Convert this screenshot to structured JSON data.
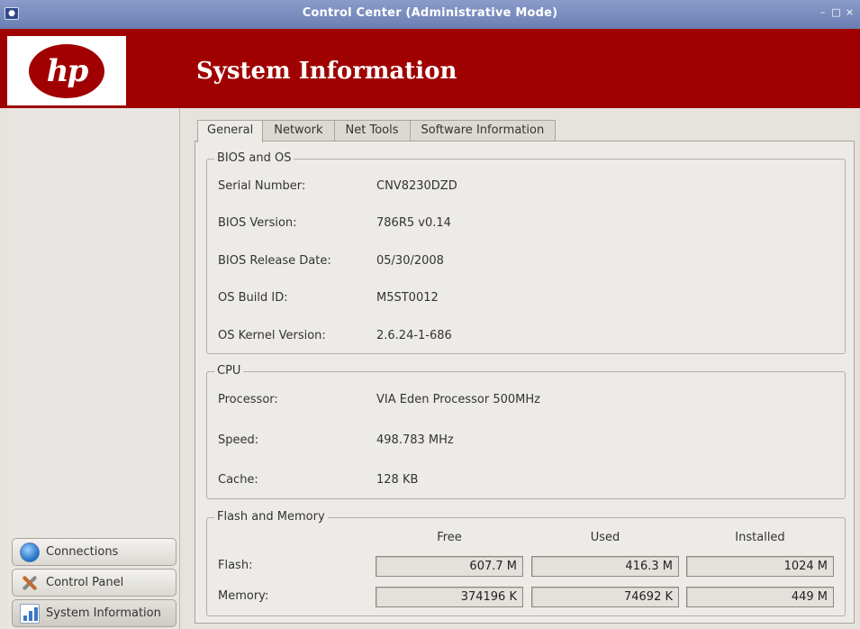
{
  "window": {
    "title": "Control Center (Administrative Mode)",
    "controls": [
      "–",
      "□",
      "×"
    ]
  },
  "header": {
    "logo_text": "hp",
    "page_title": "System Information",
    "brand_color": "#9f0000"
  },
  "sidebar": {
    "items": [
      {
        "label": "Connections",
        "icon": "globe-icon"
      },
      {
        "label": "Control Panel",
        "icon": "tools-icon"
      },
      {
        "label": "System Information",
        "icon": "chart-icon",
        "active": true
      }
    ]
  },
  "tabs": [
    {
      "label": "General",
      "active": true
    },
    {
      "label": "Network"
    },
    {
      "label": "Net Tools"
    },
    {
      "label": "Software Information"
    }
  ],
  "bios_os": {
    "title": "BIOS and OS",
    "rows": [
      {
        "label": "Serial Number:",
        "value": "CNV8230DZD"
      },
      {
        "label": "BIOS Version:",
        "value": "786R5 v0.14"
      },
      {
        "label": "BIOS Release Date:",
        "value": "05/30/2008"
      },
      {
        "label": "OS Build ID:",
        "value": "M5ST0012"
      },
      {
        "label": "OS Kernel Version:",
        "value": "2.6.24-1-686"
      }
    ]
  },
  "cpu": {
    "title": "CPU",
    "rows": [
      {
        "label": "Processor:",
        "value": "VIA Eden Processor  500MHz"
      },
      {
        "label": "Speed:",
        "value": "498.783 MHz"
      },
      {
        "label": "Cache:",
        "value": "128 KB"
      }
    ]
  },
  "flash_memory": {
    "title": "Flash and Memory",
    "columns": [
      "Free",
      "Used",
      "Installed"
    ],
    "rows": [
      {
        "label": "Flash:",
        "values": [
          "607.7 M",
          "416.3 M",
          "1024 M"
        ]
      },
      {
        "label": "Memory:",
        "values": [
          "374196 K",
          "74692 K",
          "449 M"
        ]
      }
    ]
  }
}
